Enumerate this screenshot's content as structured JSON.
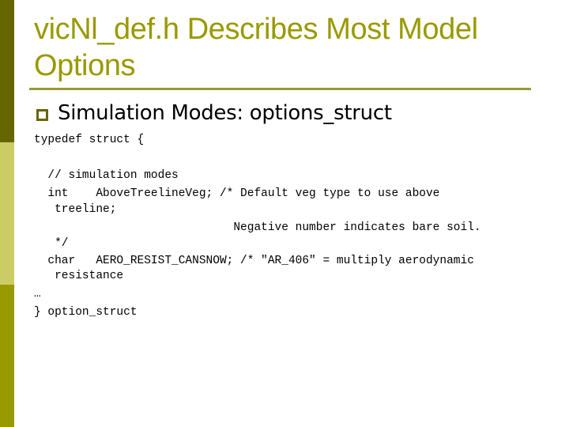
{
  "slide": {
    "title": "vicNl_def.h Describes Most Model Options",
    "bullet": "Simulation Modes: options_struct",
    "code_lines": [
      "typedef struct {",
      "  // simulation modes",
      "  int    AboveTreelineVeg; /* Default veg type to use above",
      "   treeline;",
      "                             Negative number indicates bare soil.",
      "   */",
      "  char   AERO_RESIST_CANSNOW; /* \"AR_406\" = multiply aerodynamic",
      "   resistance",
      "…",
      "} option_struct"
    ],
    "colors": {
      "title": "#999900",
      "sidebar_top": "#666600",
      "sidebar_mid": "#cccc66",
      "sidebar_bottom": "#999900"
    }
  }
}
